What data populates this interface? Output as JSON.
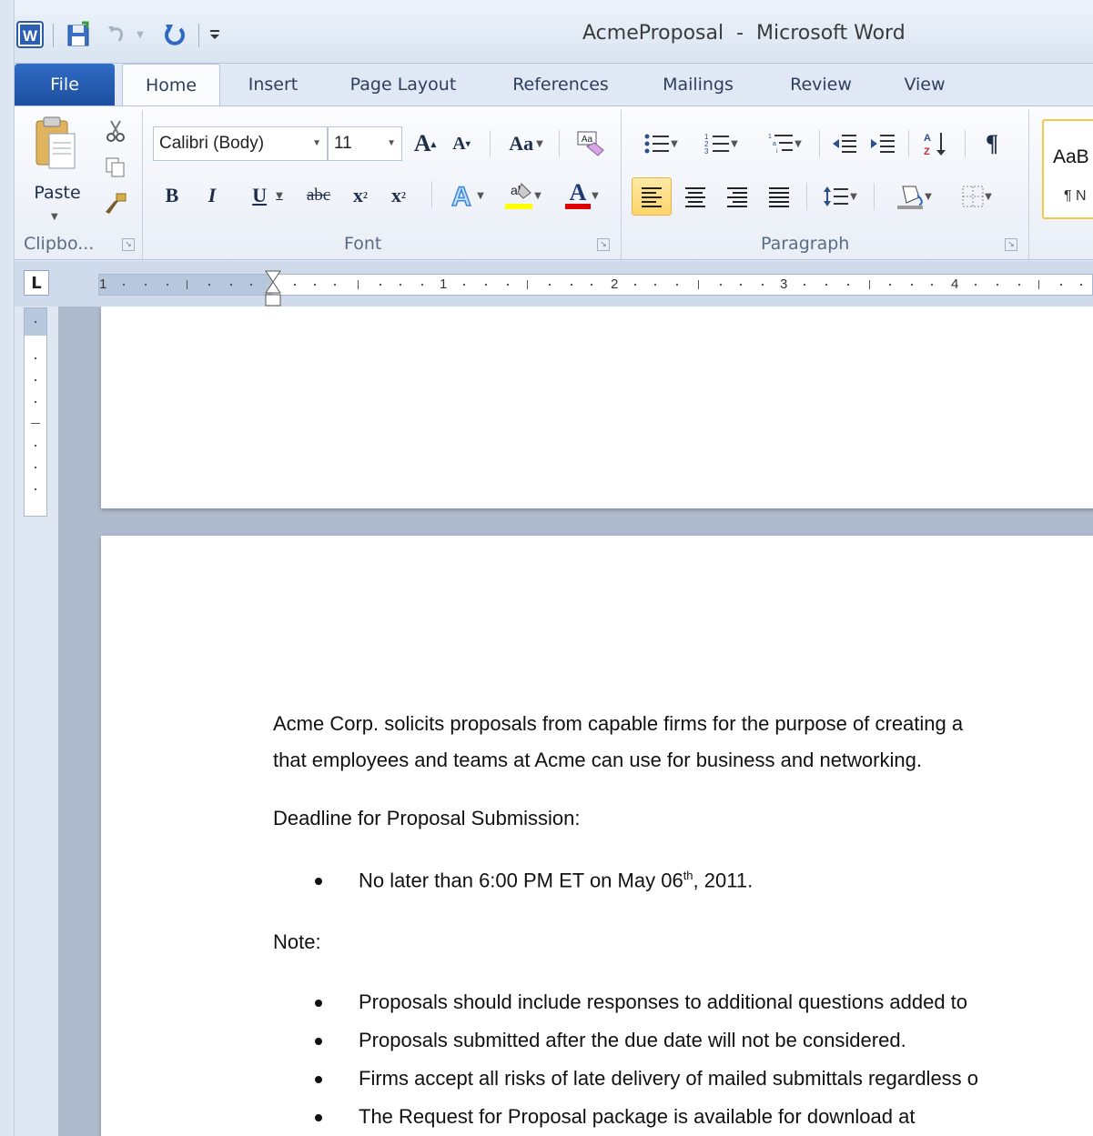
{
  "window": {
    "title": "AcmeProposal  -  Microsoft Word"
  },
  "quick_access": {
    "icons": [
      "word-app-icon",
      "save-icon",
      "undo-icon",
      "redo-icon",
      "customize-qat-icon"
    ]
  },
  "tabs": [
    "File",
    "Home",
    "Insert",
    "Page Layout",
    "References",
    "Mailings",
    "Review",
    "View"
  ],
  "ribbon": {
    "clipboard": {
      "paste_label": "Paste",
      "group_label": "Clipbo..."
    },
    "font": {
      "font_name": "Calibri (Body)",
      "font_size": "11",
      "case_label": "Aa",
      "group_label": "Font"
    },
    "paragraph": {
      "group_label": "Paragraph"
    },
    "styles": {
      "preview_text": "AaB",
      "normal_label": "¶ N"
    },
    "colors": {
      "highlight": "#ffff00",
      "font_color": "#e00000",
      "selected_button": "#ffd56a"
    }
  },
  "ruler": {
    "numbers": [
      "1",
      "2",
      "3",
      "4"
    ],
    "corner_symbol": "L"
  },
  "document": {
    "paragraph1_line1": "Acme Corp. solicits  proposals from capable firms for the purpose of creating a",
    "paragraph1_line2": "that employees and teams at Acme can use for business and networking.",
    "deadline_heading": "Deadline for Proposal Submission:",
    "deadline_bullet_pre": "No later than 6:00  PM ET on May 06",
    "deadline_bullet_sup": "th",
    "deadline_bullet_post": ", 2011.",
    "note_heading": "Note:",
    "note_bullets": [
      "Proposals should include responses to additional questions added to",
      "Proposals submitted after the due date will not be considered.",
      "Firms accept all risks of late delivery of mailed submittals regardless o",
      "The Request for Proposal package is available for download at"
    ]
  }
}
